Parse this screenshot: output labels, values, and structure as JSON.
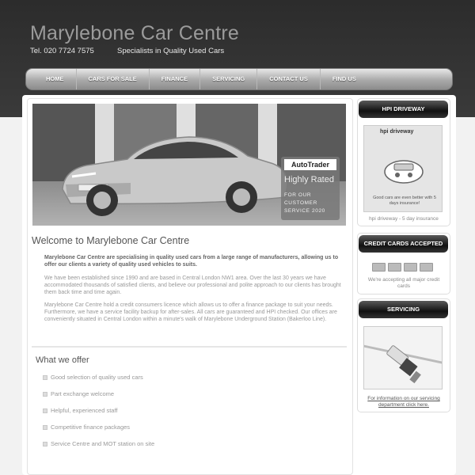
{
  "header": {
    "site_title": "Marylebone Car Centre",
    "telephone": "Tel. 020 7724 7575",
    "tagline": "Specialists in Quality Used Cars"
  },
  "nav": {
    "items": [
      "HOME",
      "CARS FOR SALE",
      "FINANCE",
      "SERVICING",
      "CONTACT US",
      "FIND US"
    ]
  },
  "hero": {
    "badge_logo": "AutoTrader",
    "badge_rated": "Highly Rated",
    "badge_sub": "FOR OUR CUSTOMER SERVICE 2020"
  },
  "main": {
    "welcome_title": "Welcome to Marylebone Car Centre",
    "paragraph_1": "Marylebone Car Centre are specialising in quality used cars from a large range of manufacturers, allowing us to offer our clients a variety of quality used vehicles to suits.",
    "paragraph_2": "We have been established since 1990 and are based in Central London NW1 area. Over the last 30 years we have accommodated thousands of satisfied clients, and believe our professional and polite approach to our clients has brought them back time and time again.",
    "paragraph_3": "Marylebone Car Centre hold a credit consumers licence which allows us to offer a finance package to suit your needs. Furthermore, we have a service facility backup for after-sales. All cars are guaranteed and HPI checked. Our offices are conveniently situated in Central London within a minute's walk of Marylebone Underground Station (Bakerloo Line).",
    "offer_title": "What we offer",
    "offer_items": [
      "Good selection of quality used cars",
      "Part exchange welcome",
      "Helpful, experienced staff",
      "Competitive finance packages",
      "Service Centre and MOT station on site"
    ]
  },
  "sidebar": {
    "hpi": {
      "heading": "HPI DRIVEWAY",
      "logo": "hpi driveway",
      "note": "Good cars are even better with 5 days insurance!",
      "caption": "hpi driveway - 5 day insurance"
    },
    "credit": {
      "heading": "CREDIT CARDS ACCEPTED",
      "note": "We're accepting all major credit cards"
    },
    "servicing": {
      "heading": "SERVICING",
      "link": "For information on our servicing department click here."
    }
  },
  "colors": {
    "header_band": "#333333",
    "nav_bar": "#a9a9a9",
    "sidebar_heading": "#1a1a1a"
  }
}
